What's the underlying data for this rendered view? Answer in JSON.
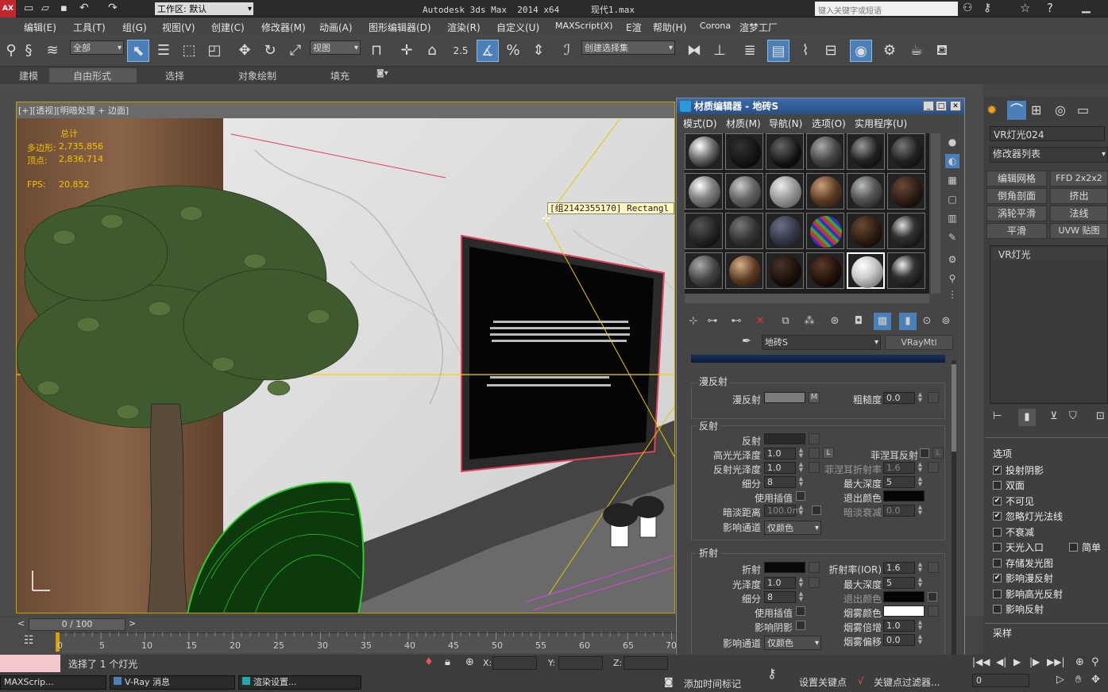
{
  "title": "Autodesk 3ds Max  2014 x64      现代1.max",
  "workspace": {
    "label": "工作区: 默认"
  },
  "search": {
    "placeholder": "键入关键字或短语"
  },
  "menu": [
    "编辑(E)",
    "工具(T)",
    "组(G)",
    "视图(V)",
    "创建(C)",
    "修改器(M)",
    "动画(A)",
    "图形编辑器(D)",
    "渲染(R)",
    "自定义(U)",
    "MAXScript(X)",
    "E渲",
    "帮助(H)",
    "Corona",
    "渲梦工厂"
  ],
  "toolbar": {
    "filter": "全部",
    "refcoord": "视图",
    "selset": "创建选择集",
    "snap": "2.5"
  },
  "ribbon": [
    "建模",
    "自由形式",
    "选择",
    "对象绘制",
    "填充"
  ],
  "viewport": {
    "label": "[+][透视][明暗处理 + 边面]",
    "stats": {
      "header": "总计",
      "poly_label": "多边形:",
      "poly_value": "2,735,856",
      "vert_label": "顶点:",
      "vert_value": "2,836,714",
      "fps_label": "FPS:",
      "fps_value": "20.852"
    },
    "tooltip": "[组2142355170] Rectangl"
  },
  "medit": {
    "title": "材质编辑器 - 地砖S",
    "menu": [
      "模式(D)",
      "材质(M)",
      "导航(N)",
      "选项(O)",
      "实用程序(U)"
    ],
    "mat_name": "地砖S",
    "mat_type": "VRayMtl",
    "diffuse": {
      "title": "漫反射",
      "diffuse": "漫反射",
      "m": "M",
      "rough": "粗糙度",
      "rough_val": "0.0"
    },
    "reflect": {
      "title": "反射",
      "reflect": "反射",
      "hilight": "高光光泽度",
      "hilight_val": "1.0",
      "l": "L",
      "fresnel": "菲涅耳反射",
      "gloss": "反射光泽度",
      "gloss_val": "1.0",
      "fresnel_ior": "菲涅耳折射率",
      "fresnel_ior_val": "1.6",
      "subdivs": "细分",
      "subdivs_val": "8",
      "maxdepth": "最大深度",
      "maxdepth_val": "5",
      "interp": "使用插值",
      "exitcolor": "退出颜色",
      "dimdist": "暗淡距离",
      "dimdist_val": "100.0m",
      "dimfall": "暗淡衰减",
      "dimfall_val": "0.0",
      "affect": "影响通道",
      "affect_val": "仅颜色"
    },
    "refract": {
      "title": "折射",
      "refract": "折射",
      "ior": "折射率(IOR)",
      "ior_val": "1.6",
      "gloss": "光泽度",
      "gloss_val": "1.0",
      "maxdepth": "最大深度",
      "maxdepth_val": "5",
      "subdivs": "细分",
      "subdivs_val": "8",
      "exitcolor": "退出颜色",
      "interp": "使用插值",
      "fogcolor": "烟雾颜色",
      "shadows": "影响阴影",
      "fogmult": "烟雾倍增",
      "fogmult_val": "1.0",
      "affect": "影响通道",
      "affect_val": "仅颜色",
      "fogbias": "烟雾偏移",
      "fogbias_val": "0.0"
    }
  },
  "right": {
    "objname": "VR灯光024",
    "modlist": "修改器列表",
    "buttons": [
      "编辑网格",
      "FFD 2x2x2",
      "倒角剖面",
      "挤出",
      "涡轮平滑",
      "法线",
      "平滑",
      "UVW 贴图"
    ],
    "stack_item": "VR灯光",
    "options_title": "选项",
    "options": [
      {
        "label": "投射阴影",
        "on": true
      },
      {
        "label": "双面",
        "on": false
      },
      {
        "label": "不可见",
        "on": true
      },
      {
        "label": "忽略灯光法线",
        "on": true
      },
      {
        "label": "不衰减",
        "on": false
      },
      {
        "label": "天光入口",
        "on": false
      },
      {
        "label": "存储发光图",
        "on": false
      },
      {
        "label": "影响漫反射",
        "on": true
      },
      {
        "label": "影响高光反射",
        "on": false
      },
      {
        "label": "影响反射",
        "on": false
      }
    ],
    "simple": "简单",
    "sampling": "采样"
  },
  "timeline": {
    "frame": "0 / 100",
    "ticks": [
      "0",
      "5",
      "10",
      "15",
      "20",
      "25",
      "30",
      "35",
      "40",
      "45",
      "50",
      "55",
      "60",
      "65",
      "70"
    ]
  },
  "status": {
    "msg": "选择了 1 个灯光",
    "x": "X:",
    "y": "Y:",
    "z": "Z:",
    "addtime": "添加时间标记",
    "setkey": "设置关键点",
    "keyfilter": "关键点过滤器...",
    "frame_val": "0"
  },
  "taskbar": [
    "MAXScrip...",
    "V-Ray 消息",
    "渲染设置..."
  ],
  "colors": {
    "accent": "#4a7fb8",
    "viewport_border": "#c9a200",
    "selected_green": "#2ecc2e"
  }
}
